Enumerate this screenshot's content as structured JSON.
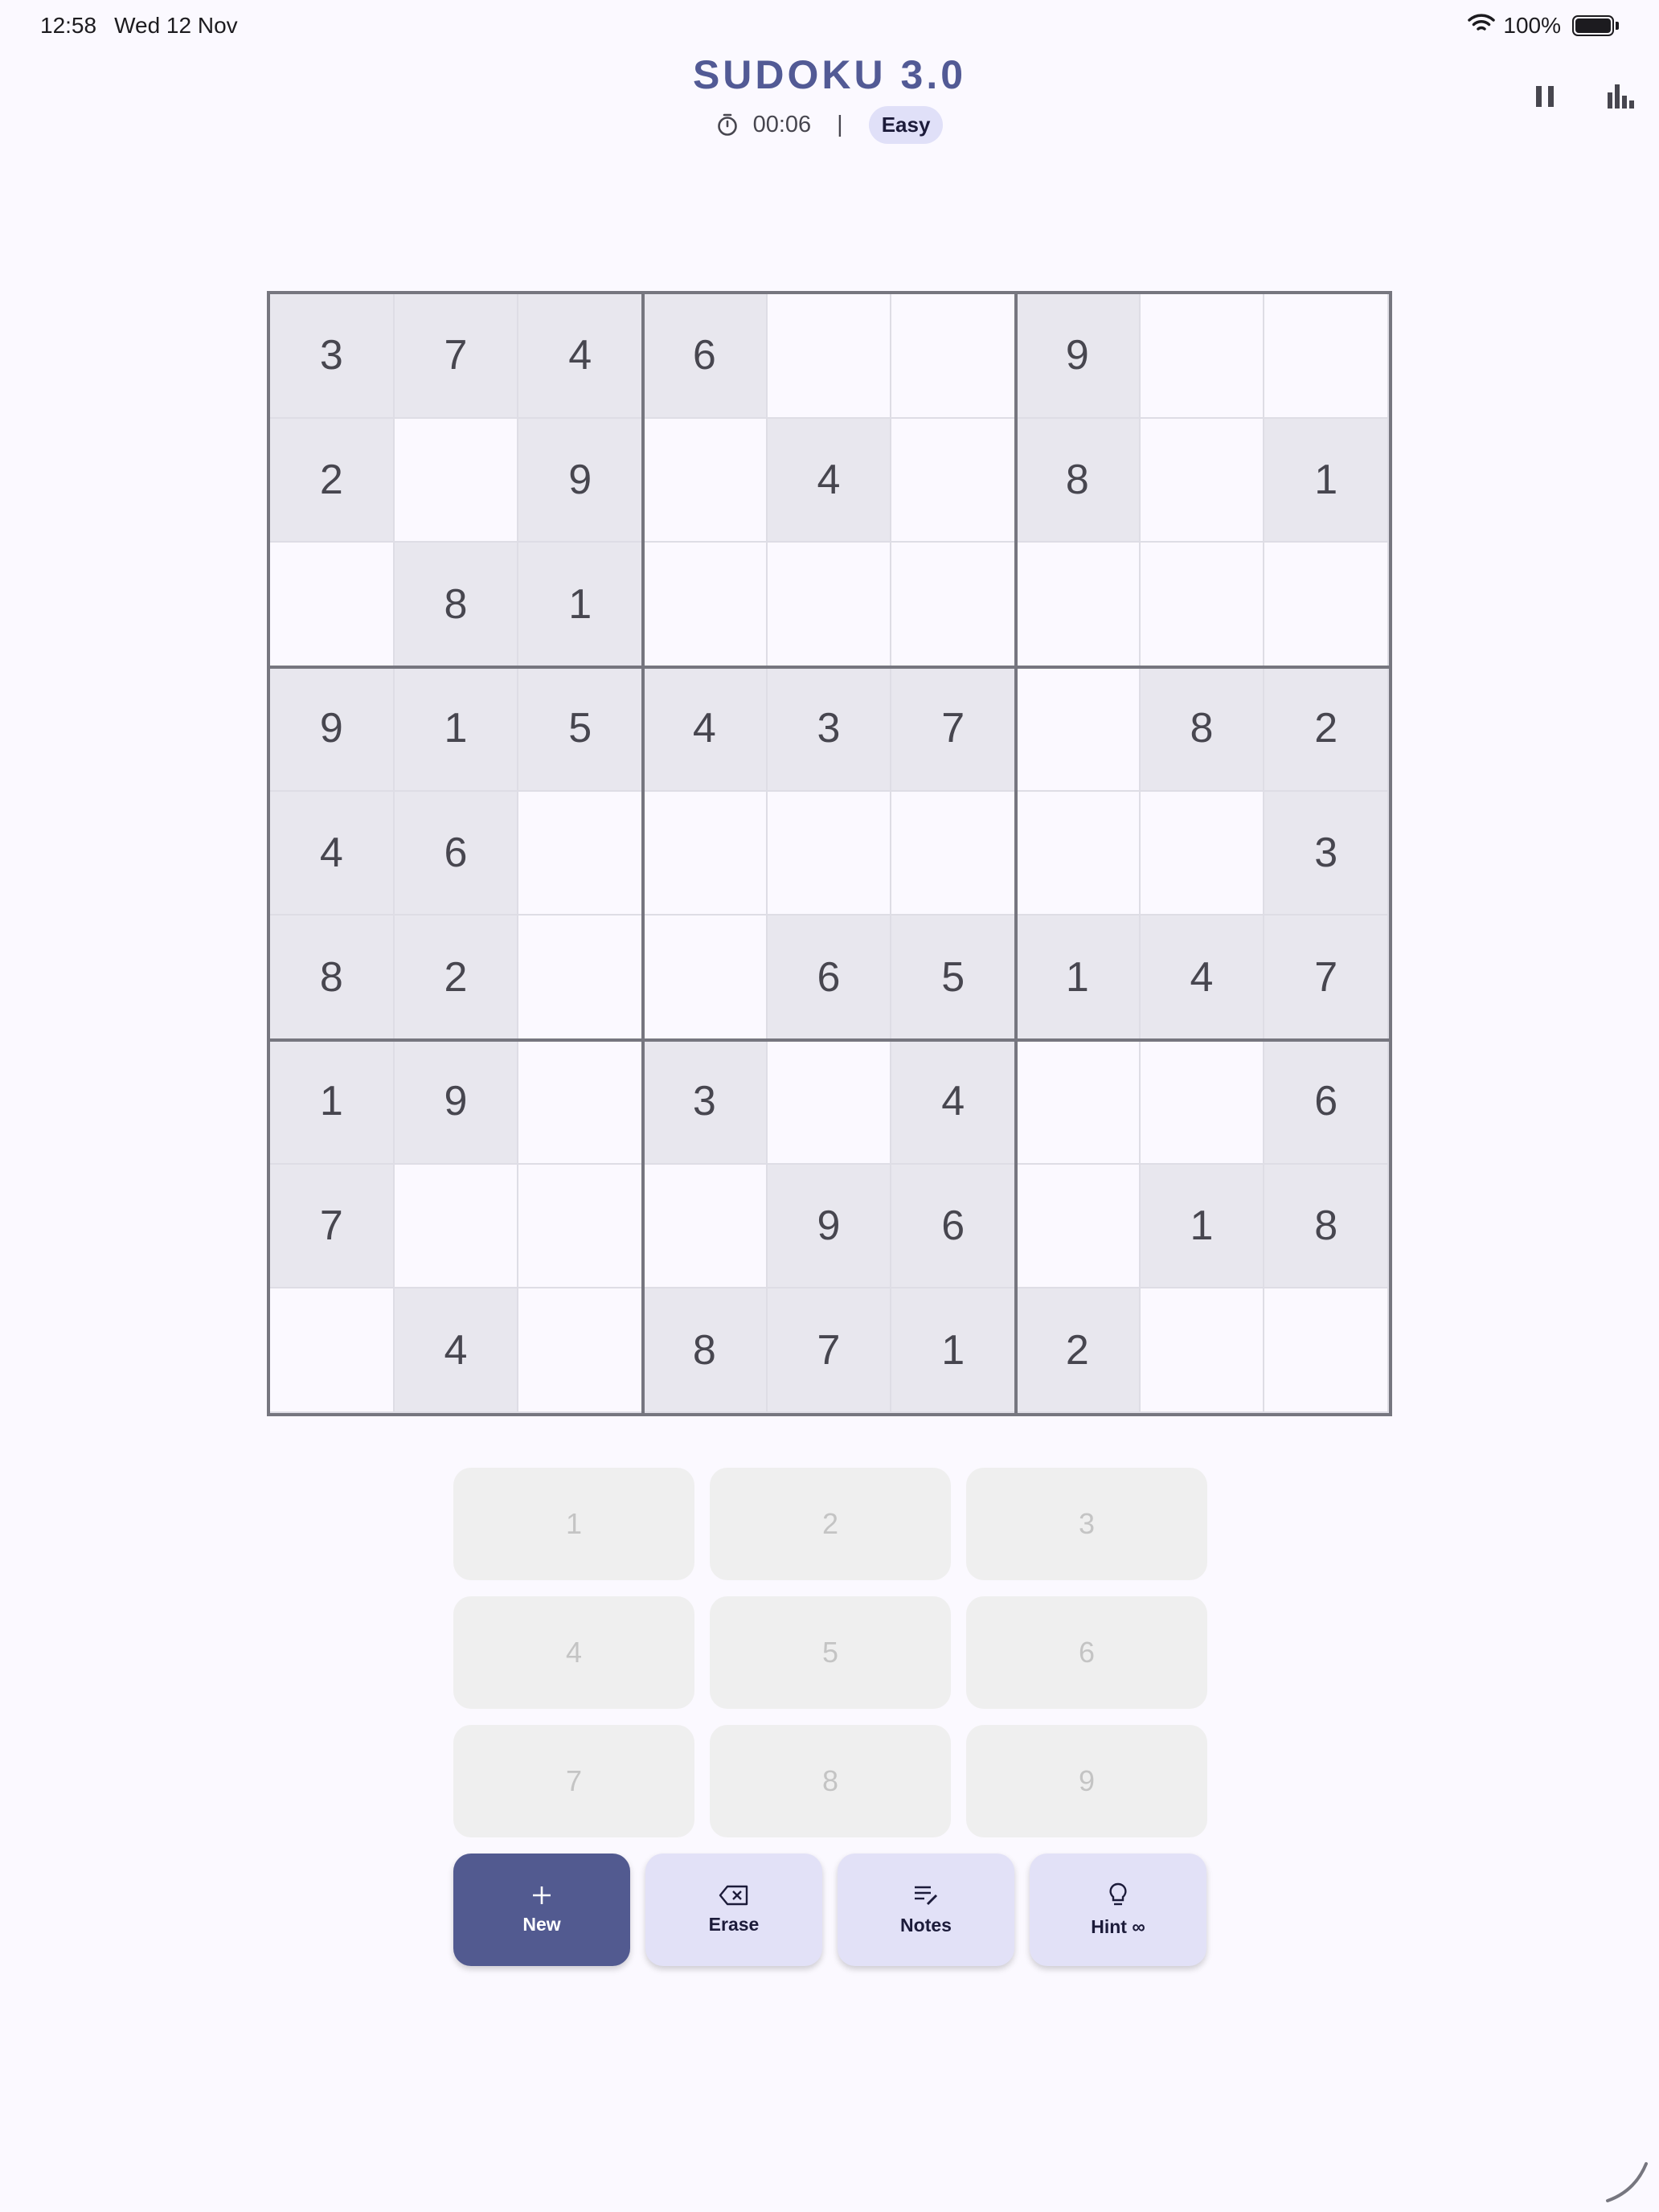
{
  "status_bar": {
    "time": "12:58",
    "date": "Wed 12 Nov",
    "battery": "100%",
    "icons": [
      "wifi-icon",
      "battery-icon"
    ]
  },
  "header": {
    "title": "SUDOKU 3.0",
    "timer": "00:06",
    "separator": "|",
    "difficulty": "Easy",
    "actions": [
      "pause-icon",
      "stats-icon"
    ]
  },
  "board": {
    "rows": [
      [
        "3",
        "7",
        "4",
        "6",
        "",
        "",
        "9",
        "",
        ""
      ],
      [
        "2",
        "",
        "9",
        "",
        "4",
        "",
        "8",
        "",
        "1"
      ],
      [
        "",
        "8",
        "1",
        "",
        "",
        "",
        "",
        "",
        ""
      ],
      [
        "9",
        "1",
        "5",
        "4",
        "3",
        "7",
        "",
        "8",
        "2"
      ],
      [
        "4",
        "6",
        "",
        "",
        "",
        "",
        "",
        "",
        "3"
      ],
      [
        "8",
        "2",
        "",
        "",
        "6",
        "5",
        "1",
        "4",
        "7"
      ],
      [
        "1",
        "9",
        "",
        "3",
        "",
        "4",
        "",
        "",
        "6"
      ],
      [
        "7",
        "",
        "",
        "",
        "9",
        "6",
        "",
        "1",
        "8"
      ],
      [
        "",
        "4",
        "",
        "8",
        "7",
        "1",
        "2",
        "",
        ""
      ]
    ]
  },
  "keypad": {
    "keys": [
      "1",
      "2",
      "3",
      "4",
      "5",
      "6",
      "7",
      "8",
      "9"
    ]
  },
  "actions": {
    "new_label": "New",
    "erase_label": "Erase",
    "notes_label": "Notes",
    "hint_label": "Hint ∞"
  },
  "colors": {
    "accent": "#525a95",
    "given_cell": "#e8e7ee",
    "badge": "#e0e0f8",
    "primary_button": "#525a90",
    "secondary_button": "#e2e1f7"
  }
}
